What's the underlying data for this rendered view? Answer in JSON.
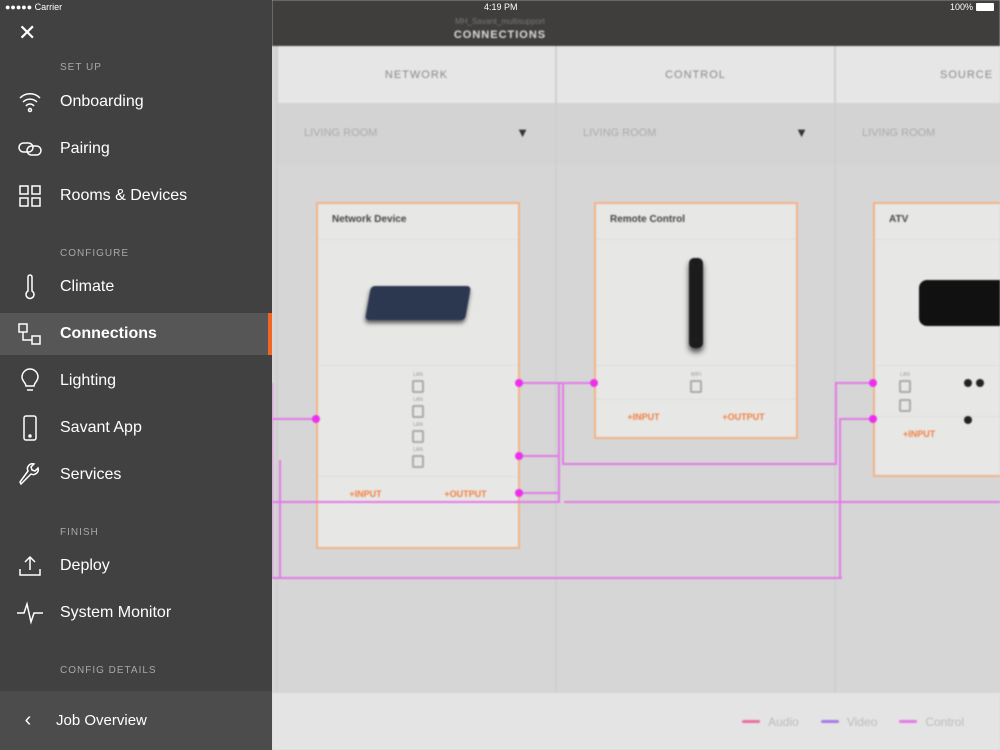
{
  "status": {
    "carrier": "●●●●● Carrier",
    "time": "4:19 PM",
    "battery": "100%"
  },
  "header": {
    "subtitle": "MH_Savant_multisupport",
    "title": "CONNECTIONS"
  },
  "sidebar": {
    "sections": {
      "setup": "SET UP",
      "configure": "CONFIGURE",
      "finish": "FINISH",
      "details": "CONFIG DETAILS"
    },
    "items": [
      {
        "label": "Onboarding",
        "icon": "wifi-icon"
      },
      {
        "label": "Pairing",
        "icon": "link-icon"
      },
      {
        "label": "Rooms & Devices",
        "icon": "grid-icon"
      },
      {
        "label": "Climate",
        "icon": "thermometer-icon"
      },
      {
        "label": "Connections",
        "icon": "connections-icon",
        "active": true
      },
      {
        "label": "Lighting",
        "icon": "lightbulb-icon"
      },
      {
        "label": "Savant App",
        "icon": "phone-icon"
      },
      {
        "label": "Services",
        "icon": "wrench-icon"
      },
      {
        "label": "Deploy",
        "icon": "upload-icon"
      },
      {
        "label": "System Monitor",
        "icon": "pulse-icon"
      }
    ],
    "job_overview": "Job Overview"
  },
  "columns": [
    {
      "header": "NETWORK",
      "room": "LIVING ROOM"
    },
    {
      "header": "CONTROL",
      "room": "LIVING ROOM"
    },
    {
      "header": "SOURCE",
      "room": "LIVING ROOM"
    }
  ],
  "cards": {
    "network": {
      "title": "Network Device",
      "port_label": "LAN",
      "input": "+INPUT",
      "output": "+OUTPUT"
    },
    "remote": {
      "title": "Remote Control",
      "port_label": "WIFI",
      "input": "+INPUT",
      "output": "+OUTPUT"
    },
    "atv": {
      "title": "ATV",
      "port_label": "LAN",
      "input": "+INPUT"
    }
  },
  "legend": [
    {
      "label": "Audio",
      "color": "#e86fa3"
    },
    {
      "label": "Video",
      "color": "#a77be8"
    },
    {
      "label": "Control",
      "color": "#e27ae6"
    }
  ],
  "accent": "#f26522"
}
